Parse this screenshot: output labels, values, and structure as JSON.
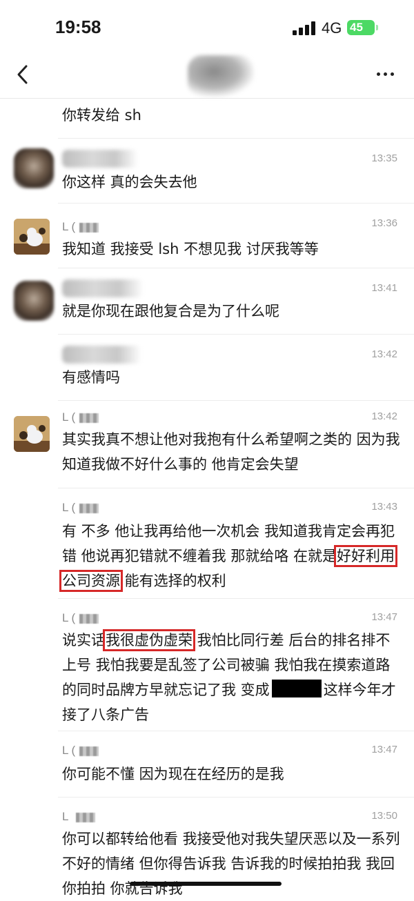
{
  "status_bar": {
    "time": "19:58",
    "network": "4G",
    "battery": "45"
  },
  "nav": {
    "back_icon": "chevron-left-icon",
    "more_icon": "more-dots-icon"
  },
  "messages": [
    {
      "name": "",
      "time": "",
      "text": "你转发给 sh"
    },
    {
      "name": "",
      "time": "13:35",
      "text": "你这样 真的会失去他"
    },
    {
      "name": "L (",
      "time": "13:36",
      "text": "我知道 我接受 lsh 不想见我 讨厌我等等"
    },
    {
      "name": "",
      "time": "13:41",
      "text": "就是你现在跟他复合是为了什么呢"
    },
    {
      "name": "",
      "time": "13:42",
      "text": "有感情吗"
    },
    {
      "name": "L (",
      "time": "13:42",
      "text": "其实我真不想让他对我抱有什么希望啊之类的 因为我知道我做不好什么事的 他肯定会失望"
    },
    {
      "name": "L (",
      "time": "13:43",
      "text_before": "有 不多 他让我再给他一次机会 我知道我肯定会再犯错 他说再犯错就不缠着我 那就给咯 在就是",
      "text_highlight": "好好利用公司资源",
      "text_after": " 能有选择的权利"
    },
    {
      "name": "L (",
      "time": "13:47",
      "text_before": "说实话",
      "text_highlight": "我很虚伪虚荣",
      "text_mid": " 我怕比同行差 后台的排名排不上号 我怕我要是乱签了公司被骗 我怕我在摸索道路的同时品牌方早就忘记了我 变成",
      "text_after": "这样今年才接了八条广告"
    },
    {
      "name": "L (",
      "time": "13:47",
      "text": "你可能不懂 因为现在在经历的是我"
    },
    {
      "name": "L ",
      "time": "13:50",
      "text": "你可以都转给他看 我接受他对我失望厌恶以及一系列不好的情绪 但你得告诉我 告诉我的时候拍拍我 我回你拍拍 你就告诉我"
    }
  ]
}
